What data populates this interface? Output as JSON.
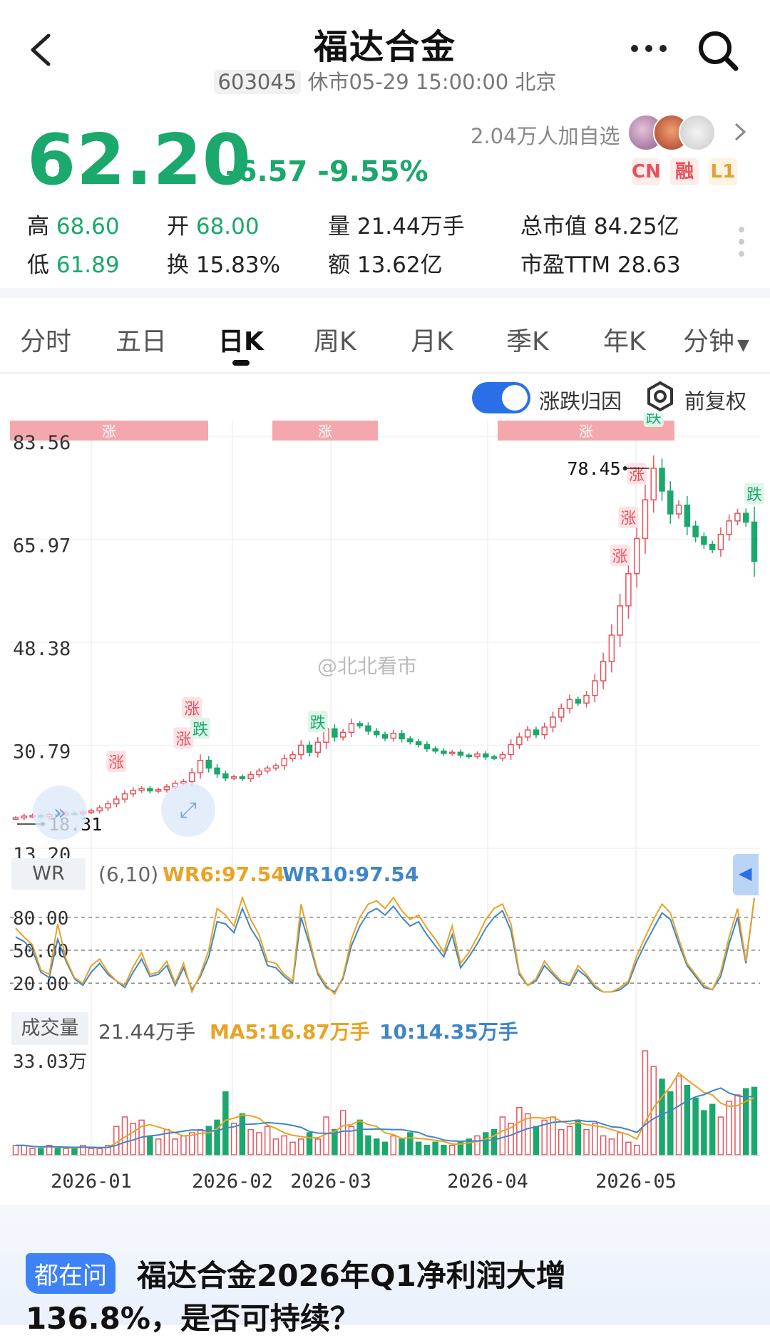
{
  "header": {
    "title": "福达合金",
    "code": "603045",
    "status": "休市05-29 15:00:00 北京"
  },
  "quote": {
    "price": "62.20",
    "change": "-6.57",
    "change_pct": "-9.55%",
    "followers": "2.04万人加自选",
    "tags": [
      "CN",
      "融",
      "L1"
    ],
    "colors": {
      "down": "#1aa86c",
      "up": "#e8525c",
      "tag_bg": "#fdecea",
      "tag_l1_bg": "#fdf3e0",
      "tag_l1_fg": "#d9a53a"
    }
  },
  "stats": {
    "high_label": "高",
    "high": "68.60",
    "low_label": "低",
    "low": "61.89",
    "open_label": "开",
    "open": "68.00",
    "turnover_label": "换",
    "turnover": "15.83%",
    "volume_label": "量",
    "volume": "21.44万手",
    "amount_label": "额",
    "amount": "13.62亿",
    "mktcap_label": "总市值",
    "mktcap": "84.25亿",
    "pe_label": "市盈TTM",
    "pe": "28.63"
  },
  "tabs": [
    "分时",
    "五日",
    "日K",
    "周K",
    "月K",
    "季K",
    "年K",
    "分钟"
  ],
  "active_tab": "日K",
  "options": {
    "attribution": "涨跌归因",
    "attribution_on": true,
    "adjust": "前复权"
  },
  "watermark": "@北北看市",
  "chart_data": {
    "type": "candlestick",
    "y_ticks": [
      "83.56",
      "65.97",
      "48.38",
      "30.79",
      "13.20"
    ],
    "x_ticks": [
      "2026-01",
      "2026-02",
      "2026-03",
      "2026-04",
      "2026-05"
    ],
    "high_marker": "78.45",
    "low_marker": "18.31",
    "markers_up": "涨",
    "markers_down": "跌",
    "closes": [
      18.4,
      18.7,
      18.8,
      18.6,
      19.0,
      18.9,
      19.2,
      19.1,
      19.4,
      19.6,
      20.1,
      20.8,
      21.6,
      22.5,
      23.1,
      23.4,
      23.0,
      23.2,
      23.7,
      24.3,
      24.6,
      26.1,
      28.2,
      26.9,
      25.9,
      25.2,
      25.4,
      25.1,
      25.8,
      26.4,
      26.9,
      27.3,
      28.5,
      29.2,
      30.8,
      29.6,
      31.3,
      33.6,
      32.2,
      33.0,
      34.5,
      34.1,
      33.2,
      32.6,
      32.0,
      32.8,
      31.9,
      31.4,
      30.9,
      30.2,
      29.8,
      29.4,
      29.6,
      29.1,
      28.9,
      29.3,
      28.8,
      28.6,
      29.2,
      30.9,
      32.2,
      33.4,
      32.6,
      33.9,
      35.6,
      37.1,
      38.6,
      38.0,
      39.3,
      41.8,
      45.1,
      49.6,
      54.6,
      60.1,
      66.1,
      72.7,
      78.1,
      74.2,
      70.3,
      71.8,
      68.2,
      66.4,
      65.1,
      64.2,
      66.8,
      69.1,
      70.4,
      68.9,
      62.2
    ]
  },
  "wr": {
    "label": "WR",
    "params": "(6,10)",
    "wr6_label": "WR6:97.54",
    "wr10_label": "WR10:97.54",
    "levels": [
      "80.00",
      "50.00",
      "20.00"
    ],
    "wr6": [
      70,
      62,
      55,
      32,
      28,
      74,
      42,
      25,
      20,
      36,
      42,
      30,
      22,
      18,
      35,
      48,
      28,
      30,
      40,
      20,
      38,
      12,
      28,
      50,
      88,
      82,
      72,
      98,
      78,
      64,
      40,
      38,
      28,
      22,
      92,
      60,
      30,
      18,
      10,
      26,
      60,
      80,
      92,
      95,
      88,
      98,
      86,
      78,
      82,
      70,
      60,
      48,
      72,
      38,
      48,
      62,
      78,
      88,
      92,
      74,
      30,
      18,
      24,
      40,
      30,
      22,
      20,
      36,
      28,
      18,
      12,
      12,
      16,
      22,
      45,
      62,
      78,
      92,
      84,
      60,
      38,
      28,
      18,
      14,
      30,
      62,
      88,
      40,
      97.5
    ],
    "wr10": [
      62,
      58,
      50,
      30,
      25,
      60,
      40,
      24,
      18,
      30,
      38,
      28,
      22,
      16,
      30,
      42,
      26,
      28,
      36,
      18,
      34,
      14,
      26,
      44,
      76,
      74,
      66,
      88,
      70,
      58,
      36,
      34,
      26,
      20,
      80,
      56,
      28,
      16,
      12,
      24,
      54,
      72,
      84,
      88,
      82,
      90,
      80,
      72,
      76,
      64,
      54,
      44,
      64,
      34,
      44,
      56,
      70,
      80,
      86,
      68,
      28,
      18,
      22,
      36,
      28,
      20,
      18,
      32,
      26,
      16,
      12,
      12,
      14,
      20,
      40,
      56,
      70,
      84,
      78,
      56,
      36,
      26,
      16,
      14,
      26,
      56,
      80,
      38,
      97.5
    ],
    "colors": {
      "wr6": "#e9a325",
      "wr10": "#3f86c8"
    }
  },
  "volume": {
    "label": "成交量",
    "value": "21.44万手",
    "ma5_label": "MA5:16.87万手",
    "ma10_label": "10:14.35万手",
    "max_tick": "33.03万",
    "bars": [
      3,
      3,
      2,
      2,
      3,
      2,
      2,
      2,
      3,
      2,
      2,
      3,
      9,
      12,
      10,
      11,
      6,
      5,
      8,
      5,
      6,
      7,
      8,
      9,
      11,
      20,
      10,
      13,
      8,
      7,
      9,
      5,
      6,
      4,
      5,
      7,
      5,
      12,
      8,
      14,
      9,
      11,
      6,
      5,
      4,
      6,
      5,
      7,
      4,
      3,
      4,
      3,
      3,
      4,
      5,
      6,
      7,
      8,
      12,
      10,
      15,
      13,
      9,
      11,
      12,
      8,
      9,
      11,
      8,
      10,
      6,
      5,
      7,
      4,
      3,
      33,
      28,
      24,
      20,
      25,
      22,
      18,
      14,
      16,
      12,
      17,
      19,
      21,
      21.4
    ]
  }
}
